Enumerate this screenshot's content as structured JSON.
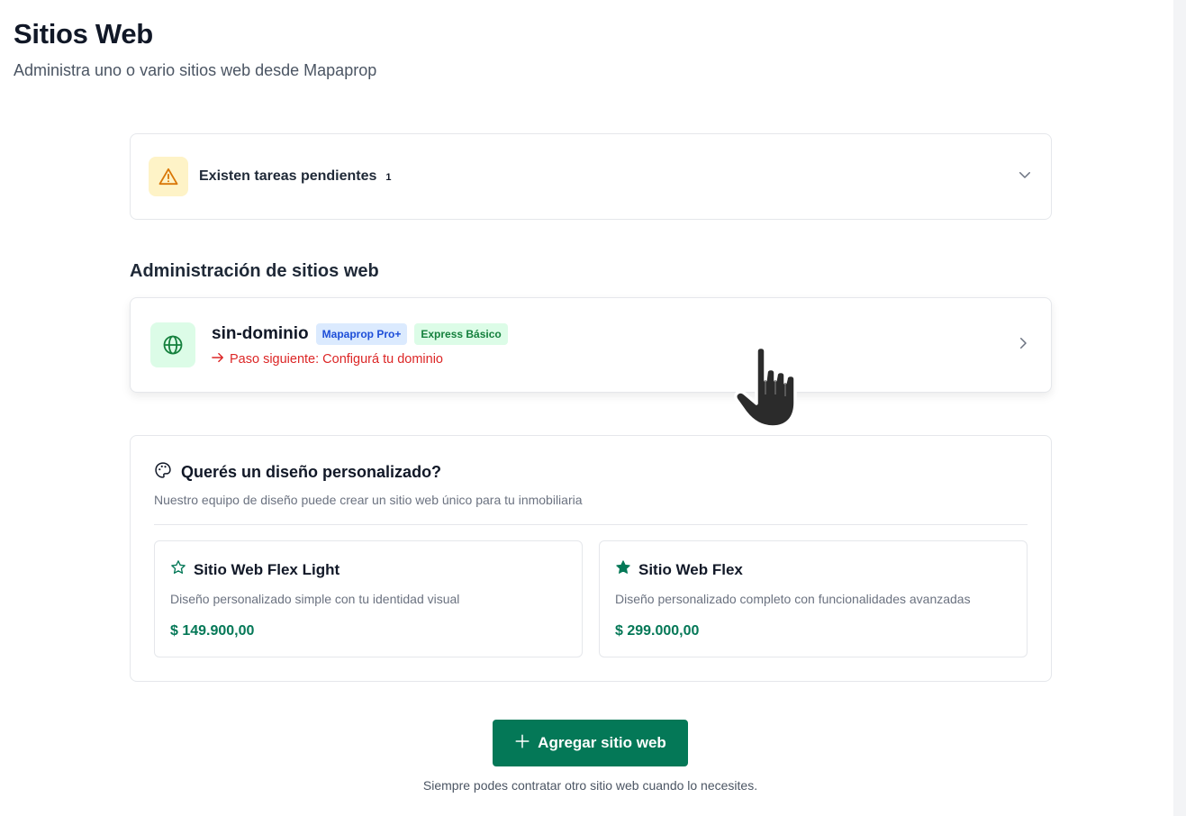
{
  "header": {
    "title": "Sitios Web",
    "subtitle": "Administra uno o vario sitios web desde Mapaprop"
  },
  "tasks": {
    "label": "Existen tareas pendientes",
    "count": "1",
    "icon": "warning-icon"
  },
  "section": {
    "title": "Administración de sitios web"
  },
  "site": {
    "name": "sin-dominio",
    "badges": [
      "Mapaprop Pro+",
      "Express Básico"
    ],
    "next_step": "Paso siguiente: Configurá tu dominio",
    "icon": "globe-icon"
  },
  "design": {
    "title": "Querés un diseño personalizado?",
    "subtitle": "Nuestro equipo de diseño puede crear un sitio web único para tu inmobiliaria",
    "plans": [
      {
        "title": "Sitio Web Flex Light",
        "description": "Diseño personalizado simple con tu identidad visual",
        "price": "$ 149.900,00",
        "icon": "star-outline-icon"
      },
      {
        "title": "Sitio Web Flex",
        "description": "Diseño personalizado completo con funcionalidades avanzadas",
        "price": "$ 299.000,00",
        "icon": "star-filled-icon"
      }
    ]
  },
  "actions": {
    "add_label": "Agregar sitio web",
    "footnote": "Siempre podes contratar otro sitio web cuando lo necesites."
  },
  "colors": {
    "primary": "#047857",
    "warning_bg": "#fef3c7",
    "danger": "#dc2626",
    "badge_blue": "#1d4ed8",
    "badge_green": "#15803d"
  }
}
